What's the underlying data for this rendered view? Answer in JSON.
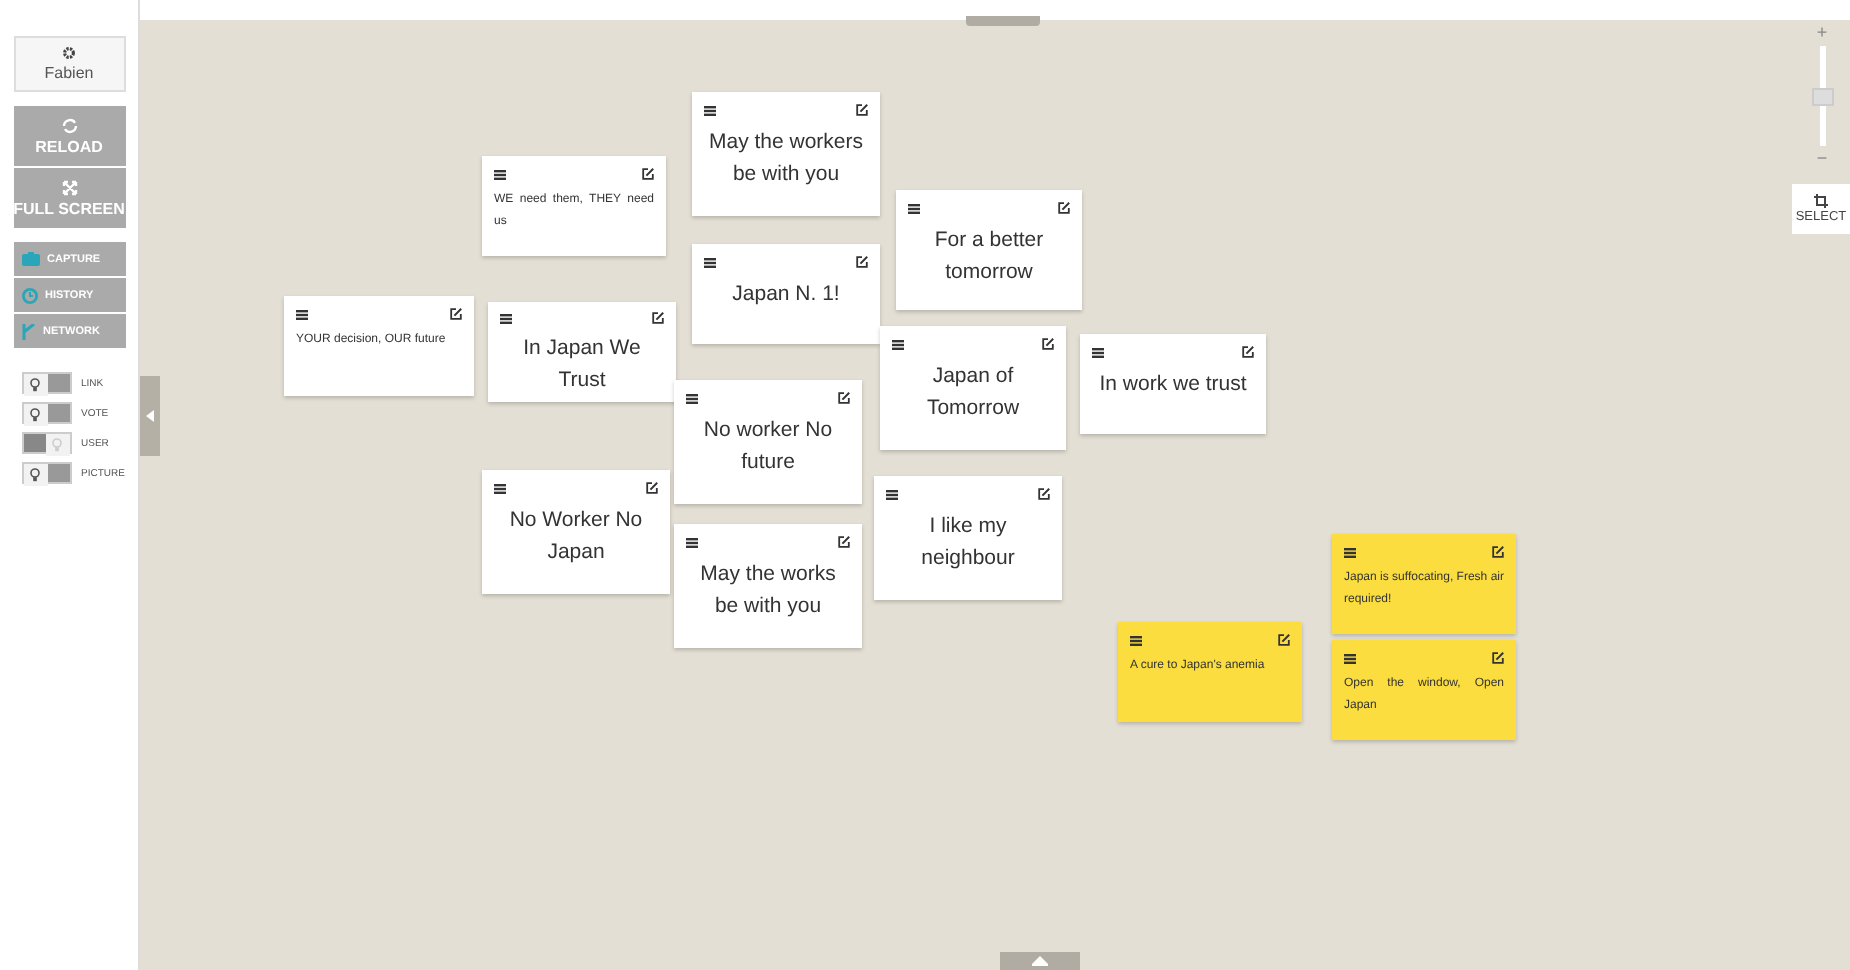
{
  "user": {
    "name": "Fabien"
  },
  "actions": [
    {
      "label": "RELOAD",
      "kind": "reload"
    },
    {
      "label": "FULL SCREEN",
      "kind": "fullscreen"
    }
  ],
  "menu": [
    {
      "label": "CAPTURE",
      "kind": "capture"
    },
    {
      "label": "HISTORY",
      "kind": "history"
    },
    {
      "label": "NETWORK",
      "kind": "network"
    }
  ],
  "toggles": [
    {
      "label": "LINK",
      "on": false
    },
    {
      "label": "VOTE",
      "on": false
    },
    {
      "label": "USER",
      "on": true
    },
    {
      "label": "PICTURE",
      "on": false
    }
  ],
  "zoom": {
    "plus": "+",
    "minus": "−",
    "level": 0.5
  },
  "select_button": {
    "label": "SELECT"
  },
  "notes": [
    {
      "text": "May the workers be with you",
      "kind": "big",
      "color": "#ffffff"
    },
    {
      "text": "WE need them, THEY need us",
      "kind": "small",
      "color": "#ffffff"
    },
    {
      "text": "For a better tomorrow",
      "kind": "big",
      "color": "#ffffff"
    },
    {
      "text": "Japan N. 1!",
      "kind": "big",
      "color": "#ffffff"
    },
    {
      "text": "YOUR decision, OUR future",
      "kind": "small",
      "color": "#ffffff"
    },
    {
      "text": "In Japan We Trust",
      "kind": "big",
      "color": "#ffffff"
    },
    {
      "text": "Japan of Tomorrow",
      "kind": "big",
      "color": "#ffffff"
    },
    {
      "text": "In work we trust",
      "kind": "big",
      "color": "#ffffff"
    },
    {
      "text": "No worker No future",
      "kind": "big",
      "color": "#ffffff"
    },
    {
      "text": "No Worker No Japan",
      "kind": "big",
      "color": "#ffffff"
    },
    {
      "text": "I like my neighbour",
      "kind": "big",
      "color": "#ffffff"
    },
    {
      "text": "May the works be with you",
      "kind": "big",
      "color": "#ffffff"
    },
    {
      "text": "Japan is suffocating, Fresh air required!",
      "kind": "small",
      "color": "#fbdd3f"
    },
    {
      "text": "A cure to Japan's anemia",
      "kind": "small",
      "color": "#fbdd3f"
    },
    {
      "text": "Open the window, Open Japan",
      "kind": "small",
      "color": "#fbdd3f"
    }
  ]
}
